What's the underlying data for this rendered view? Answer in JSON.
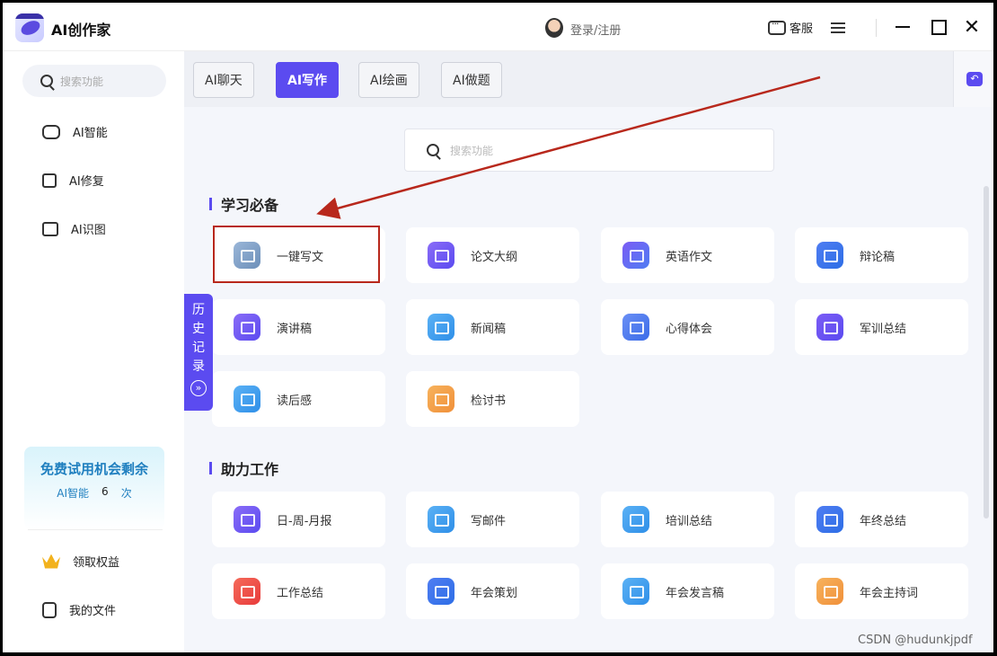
{
  "app": {
    "title": "AI创作家"
  },
  "titlebar": {
    "login": "登录/注册",
    "service": "客服"
  },
  "sidebar": {
    "search_placeholder": "搜索功能",
    "items": [
      {
        "label": "AI智能",
        "icon": "ai-smart-icon"
      },
      {
        "label": "AI修复",
        "icon": "ai-repair-icon"
      },
      {
        "label": "AI识图",
        "icon": "ai-image-recognition-icon"
      }
    ],
    "promo": {
      "title": "免费试用机会剩余",
      "label": "AI智能",
      "count": "6",
      "unit": "次"
    },
    "bottom": [
      {
        "label": "领取权益",
        "icon": "crown-icon"
      },
      {
        "label": "我的文件",
        "icon": "file-icon"
      }
    ]
  },
  "tabs": [
    {
      "label": "AI聊天",
      "active": false
    },
    {
      "label": "AI写作",
      "active": true
    },
    {
      "label": "AI绘画",
      "active": false
    },
    {
      "label": "AI做题",
      "active": false
    }
  ],
  "main_search": {
    "placeholder": "搜索功能"
  },
  "history": {
    "label": [
      "历",
      "史",
      "记",
      "录"
    ],
    "chev": "»"
  },
  "sections": [
    {
      "title": "学习必备",
      "cards": [
        "一键写文",
        "论文大纲",
        "英语作文",
        "辩论稿",
        "演讲稿",
        "新闻稿",
        "心得体会",
        "军训总结",
        "读后感",
        "检讨书"
      ]
    },
    {
      "title": "助力工作",
      "cards": [
        "日-周-月报",
        "写邮件",
        "培训总结",
        "年终总结",
        "工作总结",
        "年会策划",
        "年会发言稿",
        "年会主持词"
      ]
    }
  ],
  "colors": {
    "accent": "#5b4bf0",
    "highlight_box": "#b8281c"
  },
  "watermark": "CSDN @hudunkjpdf"
}
